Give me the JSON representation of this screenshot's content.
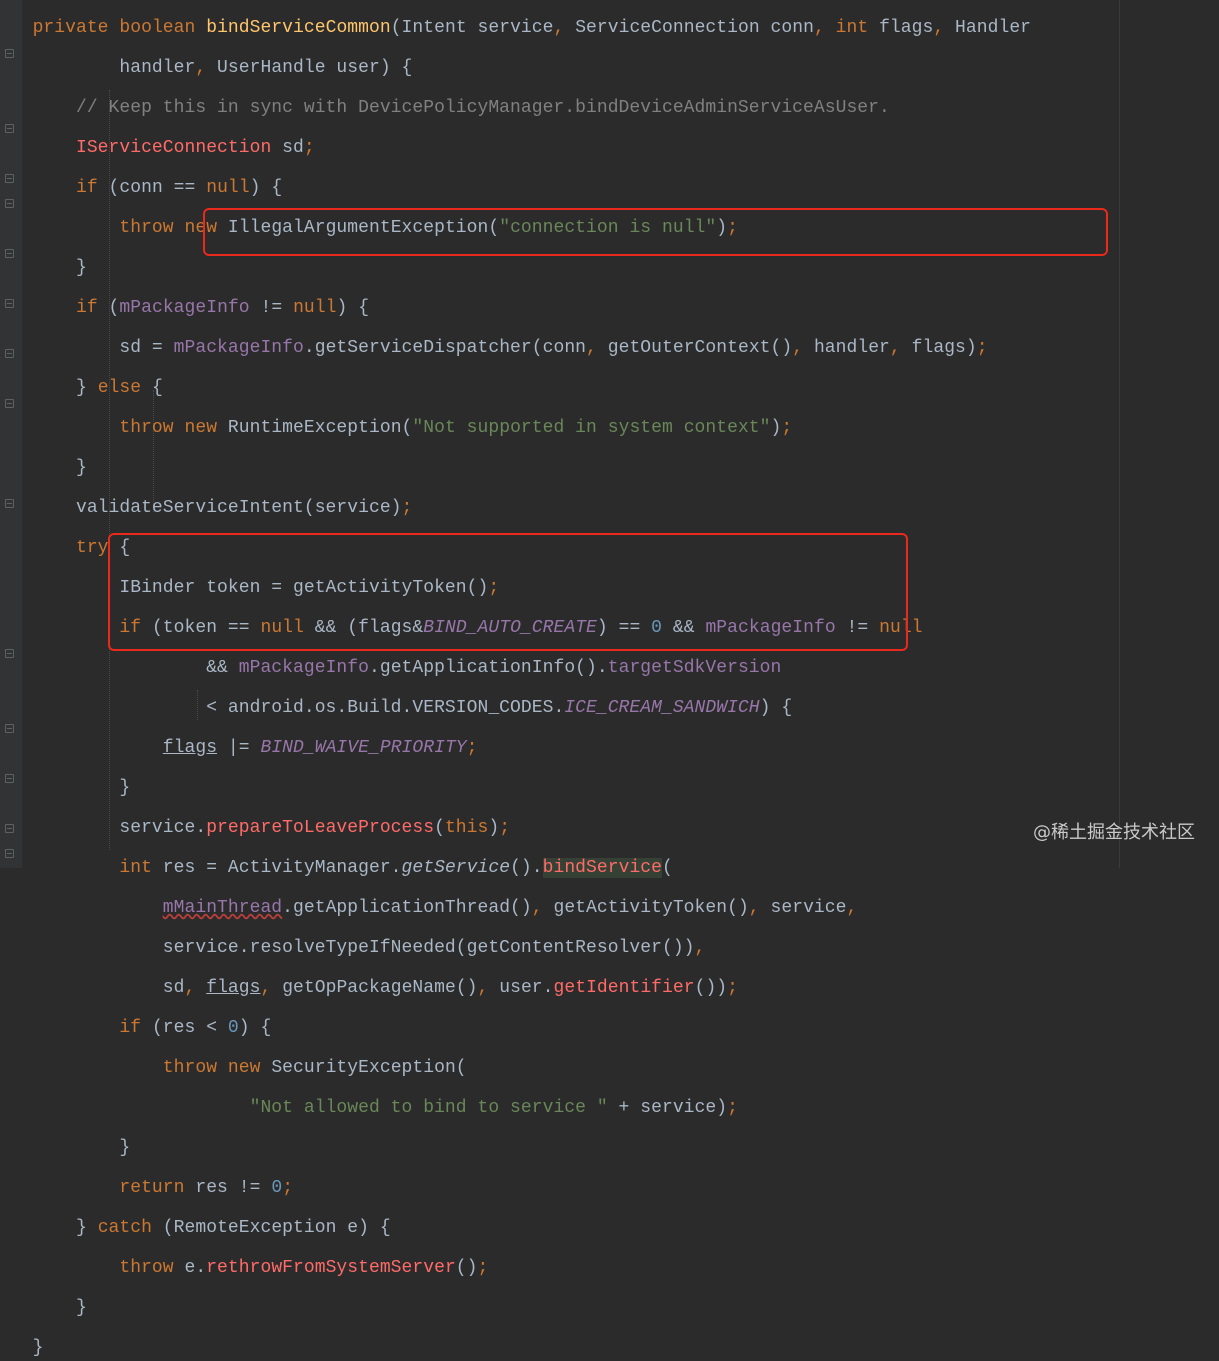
{
  "colors": {
    "background": "#2b2b2b",
    "keyword": "#cc7832",
    "method": "#ffc66d",
    "string": "#6a8759",
    "comment": "#808080",
    "field": "#9876aa",
    "number": "#6897bb",
    "highlight_box": "#e8291c"
  },
  "code_lines": [
    "    private boolean bindServiceCommon(Intent service, ServiceConnection conn, int flags, Handler",
    "            handler, UserHandle user) {",
    "        // Keep this in sync with DevicePolicyManager.bindDeviceAdminServiceAsUser.",
    "        IServiceConnection sd;",
    "        if (conn == null) {",
    "            throw new IllegalArgumentException(\"connection is null\");",
    "        }",
    "        if (mPackageInfo != null) {",
    "            sd = mPackageInfo.getServiceDispatcher(conn, getOuterContext(), handler, flags);",
    "        } else {",
    "            throw new RuntimeException(\"Not supported in system context\");",
    "        }",
    "        validateServiceIntent(service);",
    "        try {",
    "            IBinder token = getActivityToken();",
    "            if (token == null && (flags&BIND_AUTO_CREATE) == 0 && mPackageInfo != null",
    "                    && mPackageInfo.getApplicationInfo().targetSdkVersion",
    "                    < android.os.Build.VERSION_CODES.ICE_CREAM_SANDWICH) {",
    "                flags |= BIND_WAIVE_PRIORITY;",
    "            }",
    "            service.prepareToLeaveProcess(this);",
    "            int res = ActivityManager.getService().bindService(",
    "                mMainThread.getApplicationThread(), getActivityToken(), service,",
    "                service.resolveTypeIfNeeded(getContentResolver()),",
    "                sd, flags, getOpPackageName(), user.getIdentifier());",
    "            if (res < 0) {",
    "                throw new SecurityException(",
    "                        \"Not allowed to bind to service \" + service);",
    "            }",
    "            return res != 0;",
    "        } catch (RemoteException e) {",
    "            throw e.rethrowFromSystemServer();",
    "        }",
    "    }"
  ],
  "tokens": {
    "l0": [
      "private",
      "boolean",
      "bindServiceCommon",
      "(Intent service",
      ",",
      " ServiceConnection conn",
      ",",
      "int",
      " flags",
      ",",
      " Handler"
    ],
    "l1": [
      "handler",
      ",",
      " UserHandle user) {"
    ],
    "l2": [
      "// Keep this in sync with DevicePolicyManager.bindDeviceAdminServiceAsUser."
    ],
    "l3": [
      "IServiceConnection",
      " sd",
      ";"
    ],
    "l4": [
      "if",
      " (conn == ",
      "null",
      ") {"
    ],
    "l5": [
      "throw",
      "new",
      " IllegalArgumentException(",
      "\"connection is null\"",
      ")",
      ";"
    ],
    "l6": [
      "}"
    ],
    "l7": [
      "if",
      " (",
      "mPackageInfo",
      " != ",
      "null",
      ") {"
    ],
    "l8": [
      "sd = ",
      "mPackageInfo",
      ".getServiceDispatcher(conn",
      ",",
      " getOuterContext()",
      ",",
      " handler",
      ",",
      " flags)",
      ";"
    ],
    "l9": [
      "} ",
      "else",
      " {"
    ],
    "l10": [
      "throw",
      "new",
      " RuntimeException(",
      "\"Not supported in system context\"",
      ")",
      ";"
    ],
    "l11": [
      "}"
    ],
    "l12": [
      "validateServiceIntent(service)",
      ";"
    ],
    "l13": [
      "try",
      " {"
    ],
    "l14": [
      "IBinder token = getActivityToken()",
      ";"
    ],
    "l15": [
      "if",
      " (token == ",
      "null",
      " && (flags&",
      "BIND_AUTO_CREATE",
      ") == ",
      "0",
      " && ",
      "mPackageInfo",
      " != ",
      "null"
    ],
    "l16": [
      "&& ",
      "mPackageInfo",
      ".getApplicationInfo().",
      "targetSdkVersion"
    ],
    "l17": [
      "< android.os.Build.VERSION_CODES.",
      "ICE_CREAM_SANDWICH",
      ") {"
    ],
    "l18": [
      "flags",
      " |= ",
      "BIND_WAIVE_PRIORITY",
      ";"
    ],
    "l19": [
      "}"
    ],
    "l20": [
      "service.",
      "prepareToLeaveProcess",
      "(",
      "this",
      ")",
      ";"
    ],
    "l21": [
      "int",
      " res = ActivityManager.",
      "getService",
      "().",
      "bindService",
      "("
    ],
    "l22": [
      "mMainThread",
      ".getApplicationThread()",
      ",",
      " getActivityToken()",
      ",",
      " service",
      ","
    ],
    "l23": [
      "service.resolveTypeIfNeeded(getContentResolver())",
      ","
    ],
    "l24": [
      "sd",
      ",",
      "flags",
      ",",
      " getOpPackageName()",
      ",",
      " user.",
      "getIdentifier",
      "())",
      ";"
    ],
    "l25": [
      "if",
      " (res < ",
      "0",
      ") {"
    ],
    "l26": [
      "throw",
      "new",
      " SecurityException("
    ],
    "l27": [
      "\"Not allowed to bind to service \"",
      " + service)",
      ";"
    ],
    "l28": [
      "}"
    ],
    "l29": [
      "return",
      " res != ",
      "0",
      ";"
    ],
    "l30": [
      "} ",
      "catch",
      " (RemoteException e) {"
    ],
    "l31": [
      "throw",
      " e.",
      "rethrowFromSystemServer",
      "()",
      ";"
    ],
    "l32": [
      "}"
    ],
    "l33": [
      "}"
    ]
  },
  "watermark": "@稀土掘金技术社区"
}
